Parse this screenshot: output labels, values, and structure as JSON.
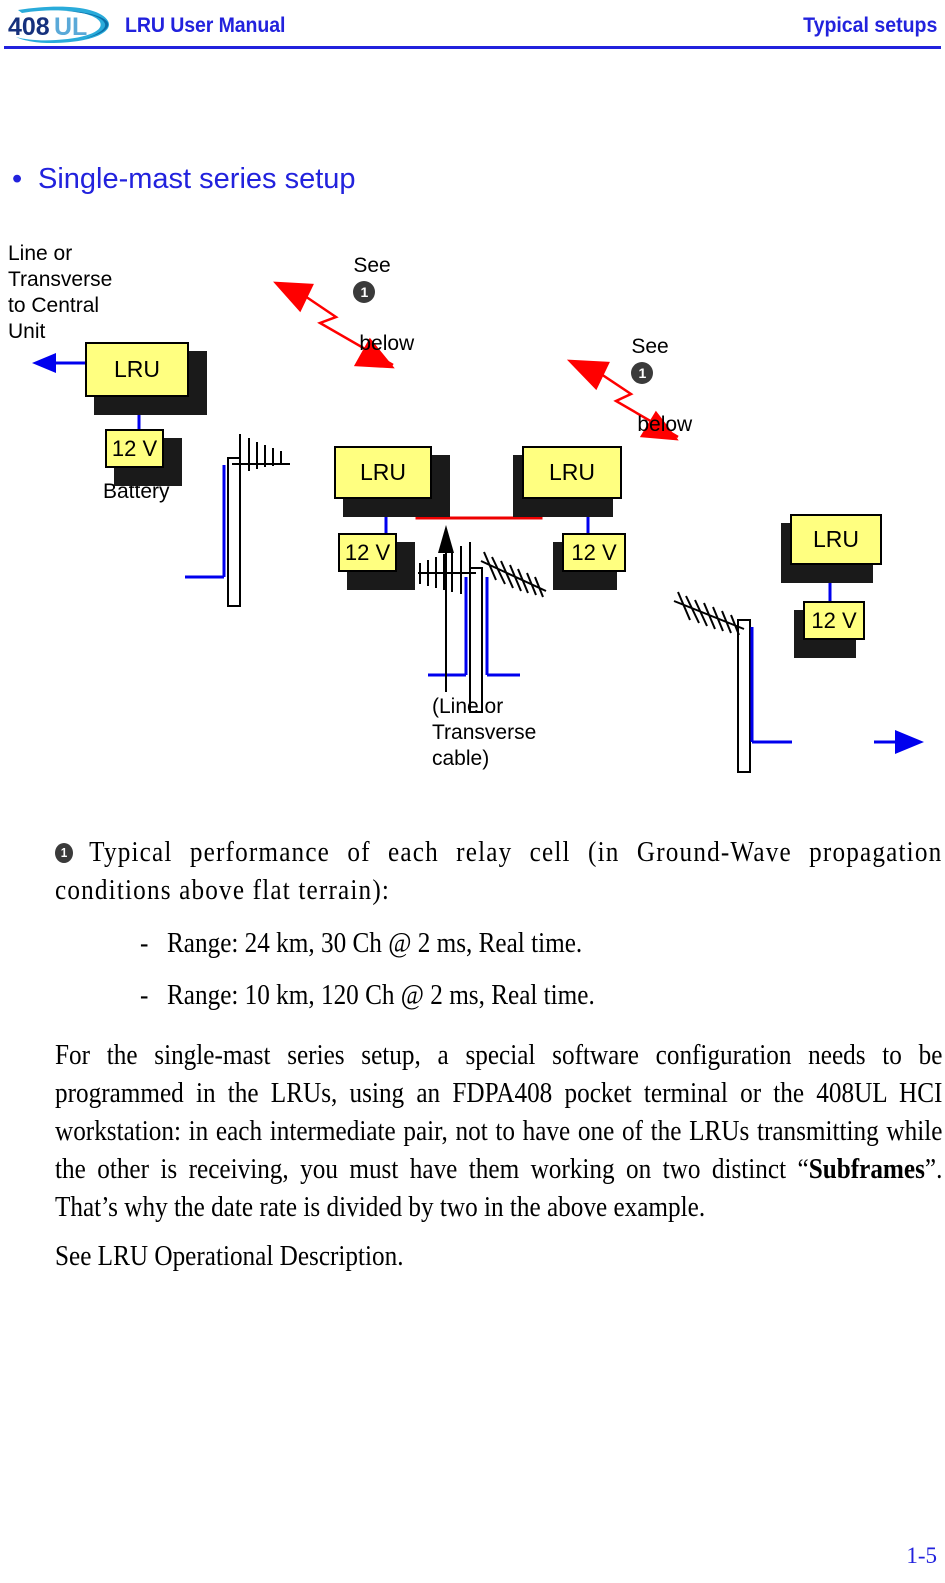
{
  "header": {
    "logo_text_dark": "408",
    "logo_text_light": "UL",
    "title": "LRU User Manual",
    "section": "Typical setups"
  },
  "section_heading": {
    "bullet": "•",
    "text": "Single-mast series setup"
  },
  "diagram": {
    "labels": {
      "left_link": "Line or\nTransverse\nto Central\nUnit",
      "battery": "Battery",
      "see_1": "See",
      "below_1": "below",
      "see_2": "See",
      "below_2": "below",
      "badge": "1",
      "center_cable": "(Line or\nTransverse\ncable)"
    },
    "units": [
      {
        "name": "lru-left",
        "label": "LRU"
      },
      {
        "name": "battery-left",
        "label": "12 V"
      },
      {
        "name": "lru-mid-left",
        "label": "LRU"
      },
      {
        "name": "battery-mid-left",
        "label": "12 V"
      },
      {
        "name": "lru-mid-right",
        "label": "LRU"
      },
      {
        "name": "battery-mid-right",
        "label": "12 V"
      },
      {
        "name": "lru-right",
        "label": "LRU"
      },
      {
        "name": "battery-right",
        "label": "12 V"
      }
    ],
    "colors": {
      "unit_fill": "#ffff80",
      "unit_shadow": "#1a1a1a",
      "cable_signal": "#0000ee",
      "cable_line": "#ee0000",
      "radio_link": "#ff0000",
      "accent": "#2222dd"
    }
  },
  "body": {
    "note_badge": "1",
    "note": "Typical performance of each relay cell (in Ground-Wave propagation conditions above flat terrain):",
    "bullets": [
      "Range: 24 km, 30 Ch @ 2 ms, Real time.",
      "Range: 10 km, 120 Ch @ 2 ms, Real time."
    ],
    "dash": "-",
    "paragraph_1a": "For the single-mast series setup, a special software configuration needs to be programmed in the LRUs, using an FDPA408 pocket terminal or the 408UL HCI workstation: in each intermediate pair, not to have one of the LRUs transmitting while the other is receiving, you must have them working on two distinct “",
    "paragraph_bold": "Subframes",
    "paragraph_1b": "”. That’s why the date rate is divided by two in the above example.",
    "paragraph_2": "See LRU Operational Description."
  },
  "footer": {
    "page_number": "1-5"
  }
}
